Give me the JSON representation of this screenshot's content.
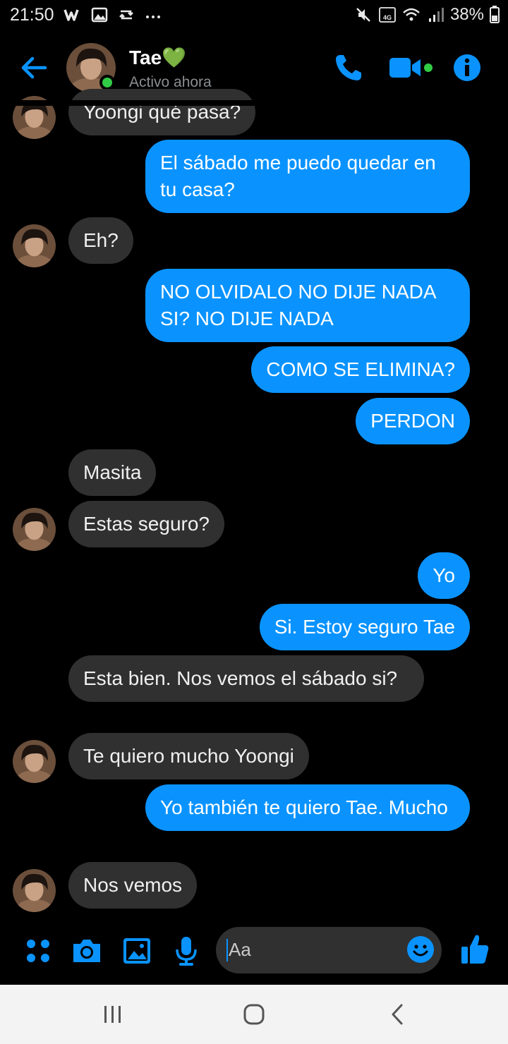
{
  "status_bar": {
    "time": "21:50",
    "battery": "38%",
    "network": "4G"
  },
  "header": {
    "contact_name": "Tae💚",
    "status": "Activo ahora",
    "accent_color": "#0a93ff",
    "online_color": "#31cc46"
  },
  "messages": [
    {
      "side": "in",
      "text": "Yoongi qué pasa?"
    },
    {
      "side": "out",
      "text": "El sábado me puedo quedar en tu casa?"
    },
    {
      "side": "in",
      "text": "Eh?"
    },
    {
      "side": "out",
      "text": "NO OLVIDALO NO DIJE NADA SI? NO DIJE NADA"
    },
    {
      "side": "out",
      "text": "COMO SE ELIMINA?"
    },
    {
      "side": "out",
      "text": "PERDON"
    },
    {
      "side": "in",
      "text": "Masita"
    },
    {
      "side": "in",
      "text": "Estas seguro?"
    },
    {
      "side": "out",
      "text": "Yo"
    },
    {
      "side": "out",
      "text": "Si. Estoy seguro Tae"
    },
    {
      "side": "in",
      "text": "Esta bien. Nos vemos el sábado si?"
    },
    {
      "side": "in",
      "text": "Te quiero mucho Yoongi"
    },
    {
      "side": "out",
      "text": "Yo también te quiero Tae. Mucho"
    },
    {
      "side": "in",
      "text": "Nos vemos"
    }
  ],
  "composer": {
    "placeholder": "Aa"
  }
}
